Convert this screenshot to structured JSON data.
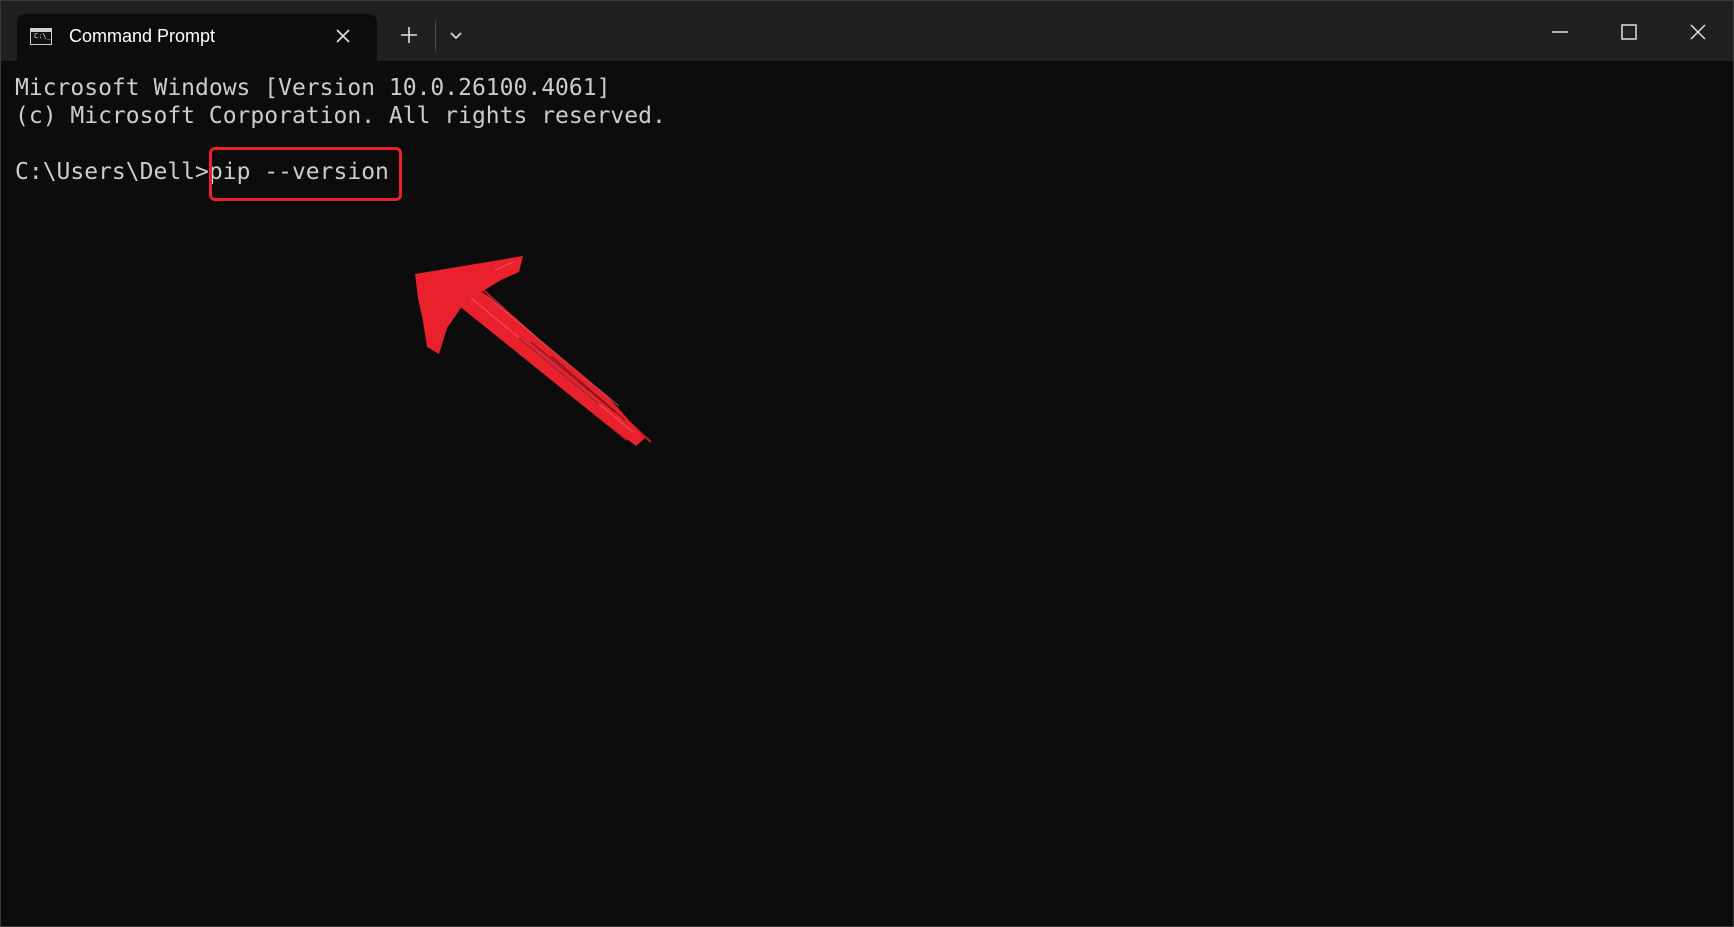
{
  "window": {
    "tab_title": "Command Prompt",
    "tab_icon": "terminal-icon"
  },
  "controls": {
    "new_tab_icon": "plus-icon",
    "dropdown_icon": "chevron-down-icon",
    "minimize_icon": "minimize-icon",
    "maximize_icon": "maximize-icon",
    "close_icon": "close-icon"
  },
  "console": {
    "line1": "Microsoft Windows [Version 10.0.26100.4061]",
    "line2": "(c) Microsoft Corporation. All rights reserved.",
    "prompt": "C:\\Users\\Dell>",
    "command": "pip --version"
  },
  "annotation": {
    "color": "#e8212d"
  }
}
